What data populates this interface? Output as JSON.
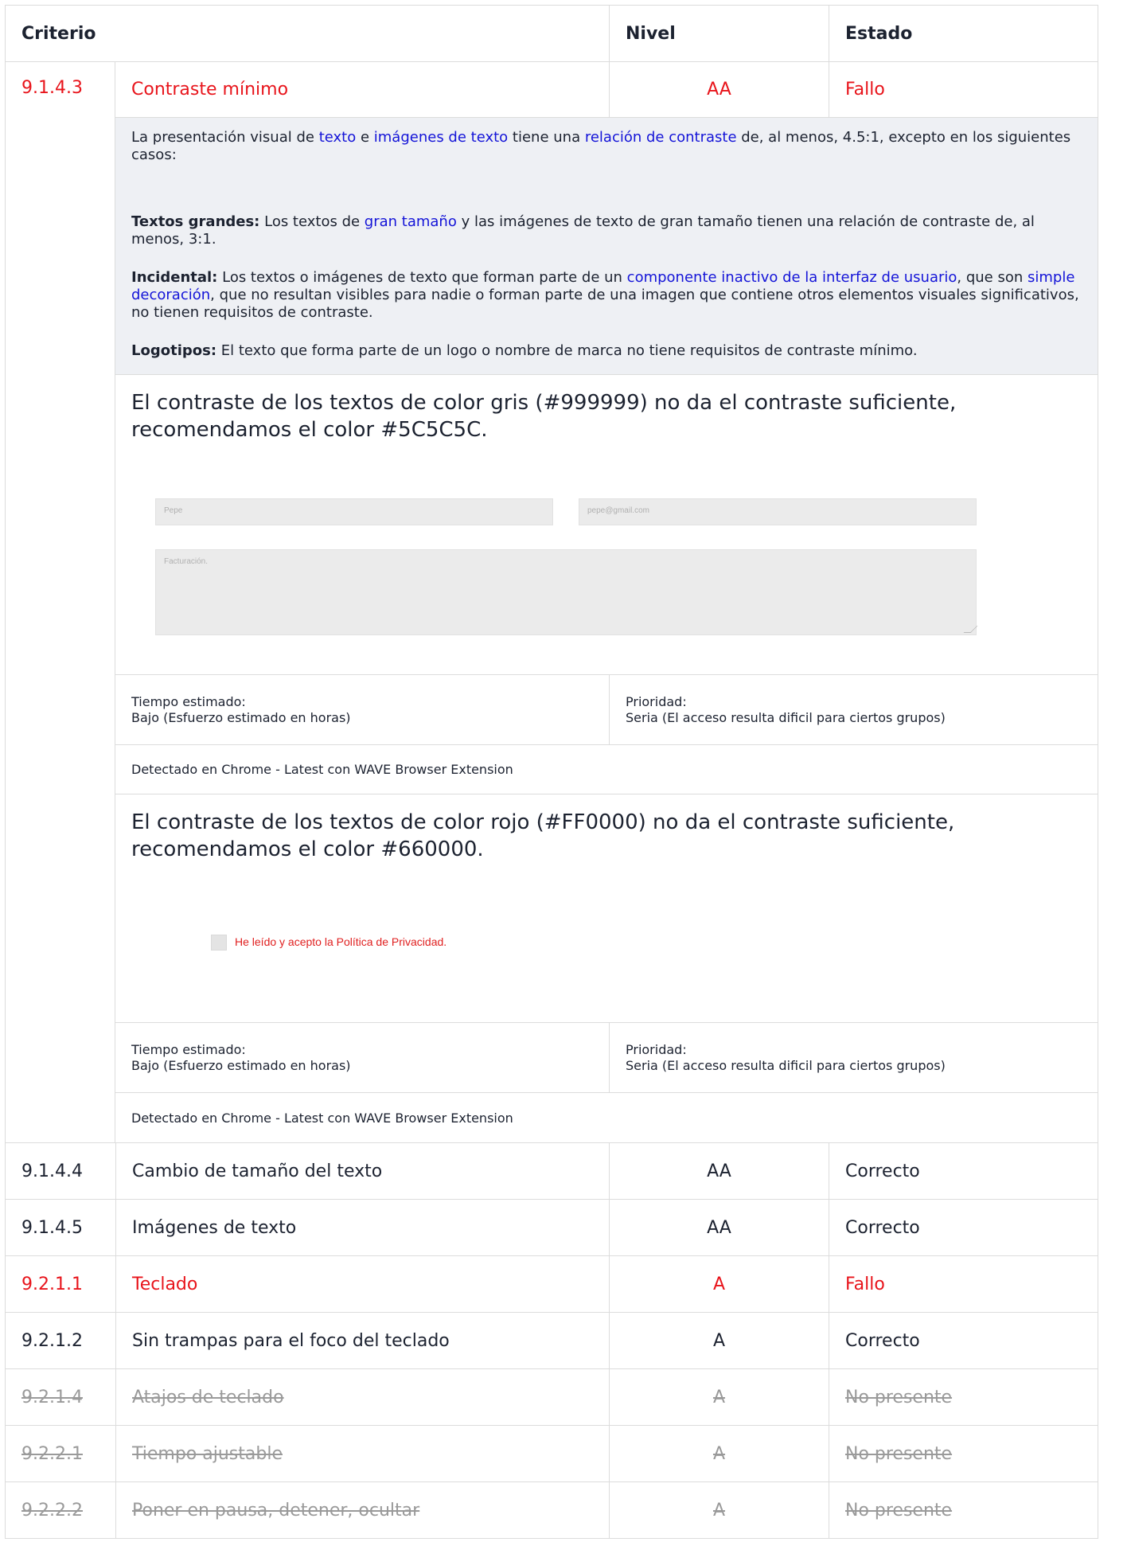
{
  "header": {
    "criterio": "Criterio",
    "nivel": "Nivel",
    "estado": "Estado"
  },
  "expanded": {
    "num": "9.1.4.3",
    "name": "Contraste mínimo",
    "level": "AA",
    "status": "Fallo",
    "description": {
      "p1_a": "La presentación visual de ",
      "p1_link1": "texto",
      "p1_b": " e ",
      "p1_link2": "imágenes de texto",
      "p1_c": " tiene una ",
      "p1_link3": "relación de contraste",
      "p1_d": " de, al menos, 4.5:1, excepto en los siguientes casos:",
      "p2_bold": "Textos grandes:",
      "p2_a": " Los textos de ",
      "p2_link": "gran tamaño",
      "p2_b": " y las imágenes de texto de gran tamaño tienen una relación de contraste de, al menos, 3:1.",
      "p3_bold": "Incidental:",
      "p3_a": " Los textos o imágenes de texto que forman parte de un ",
      "p3_link1": "componente inactivo de la interfaz de usuario",
      "p3_b": ", que son ",
      "p3_link2": "simple decoración",
      "p3_c": ", que no resultan visibles para nadie o forman parte de una imagen que contiene otros elementos visuales significativos, no tienen requisitos de contraste.",
      "p4_bold": "Logotipos:",
      "p4_a": " El texto que forma parte de un logo o nombre de marca no tiene requisitos de contraste mínimo."
    },
    "issues": [
      {
        "title": "El contraste de los textos de color gris (#999999) no da el contraste suficiente, recomendamos el color #5C5C5C.",
        "screenshot": {
          "name_placeholder": "Pepe",
          "email_placeholder": "pepe@gmail.com",
          "textarea_placeholder": "Facturación."
        },
        "time_label": "Tiempo estimado:",
        "time_value": "Bajo (Esfuerzo estimado en horas)",
        "priority_label": "Prioridad:",
        "priority_value": "Seria (El acceso resulta dificil para ciertos grupos)",
        "detected": "Detectado en Chrome - Latest con WAVE Browser Extension"
      },
      {
        "title": "El contraste de los textos de color rojo (#FF0000) no da el contraste suficiente, recomendamos el color #660000.",
        "screenshot": {
          "checkbox_label": "He leído y acepto la Política de Privacidad."
        },
        "time_label": "Tiempo estimado:",
        "time_value": "Bajo (Esfuerzo estimado en horas)",
        "priority_label": "Prioridad:",
        "priority_value": "Seria (El acceso resulta dificil para ciertos grupos)",
        "detected": "Detectado en Chrome - Latest con WAVE Browser Extension"
      }
    ]
  },
  "rows": [
    {
      "num": "9.1.4.4",
      "name": "Cambio de tamaño del texto",
      "level": "AA",
      "status": "Correcto"
    },
    {
      "num": "9.1.4.5",
      "name": "Imágenes de texto",
      "level": "AA",
      "status": "Correcto"
    },
    {
      "num": "9.2.1.1",
      "name": "Teclado",
      "level": "A",
      "status": "Fallo"
    },
    {
      "num": "9.2.1.2",
      "name": "Sin trampas para el foco del teclado",
      "level": "A",
      "status": "Correcto"
    },
    {
      "num": "9.2.1.4",
      "name": "Atajos de teclado",
      "level": "A",
      "status": "No presente"
    },
    {
      "num": "9.2.2.1",
      "name": "Tiempo ajustable",
      "level": "A",
      "status": "No presente"
    },
    {
      "num": "9.2.2.2",
      "name": "Poner en pausa, detener, ocultar",
      "level": "A",
      "status": "No presente"
    }
  ],
  "colors": {
    "fail": "#e8141b",
    "absent": "#9a9a9a",
    "link": "#1414d8",
    "text": "#1c2230"
  }
}
